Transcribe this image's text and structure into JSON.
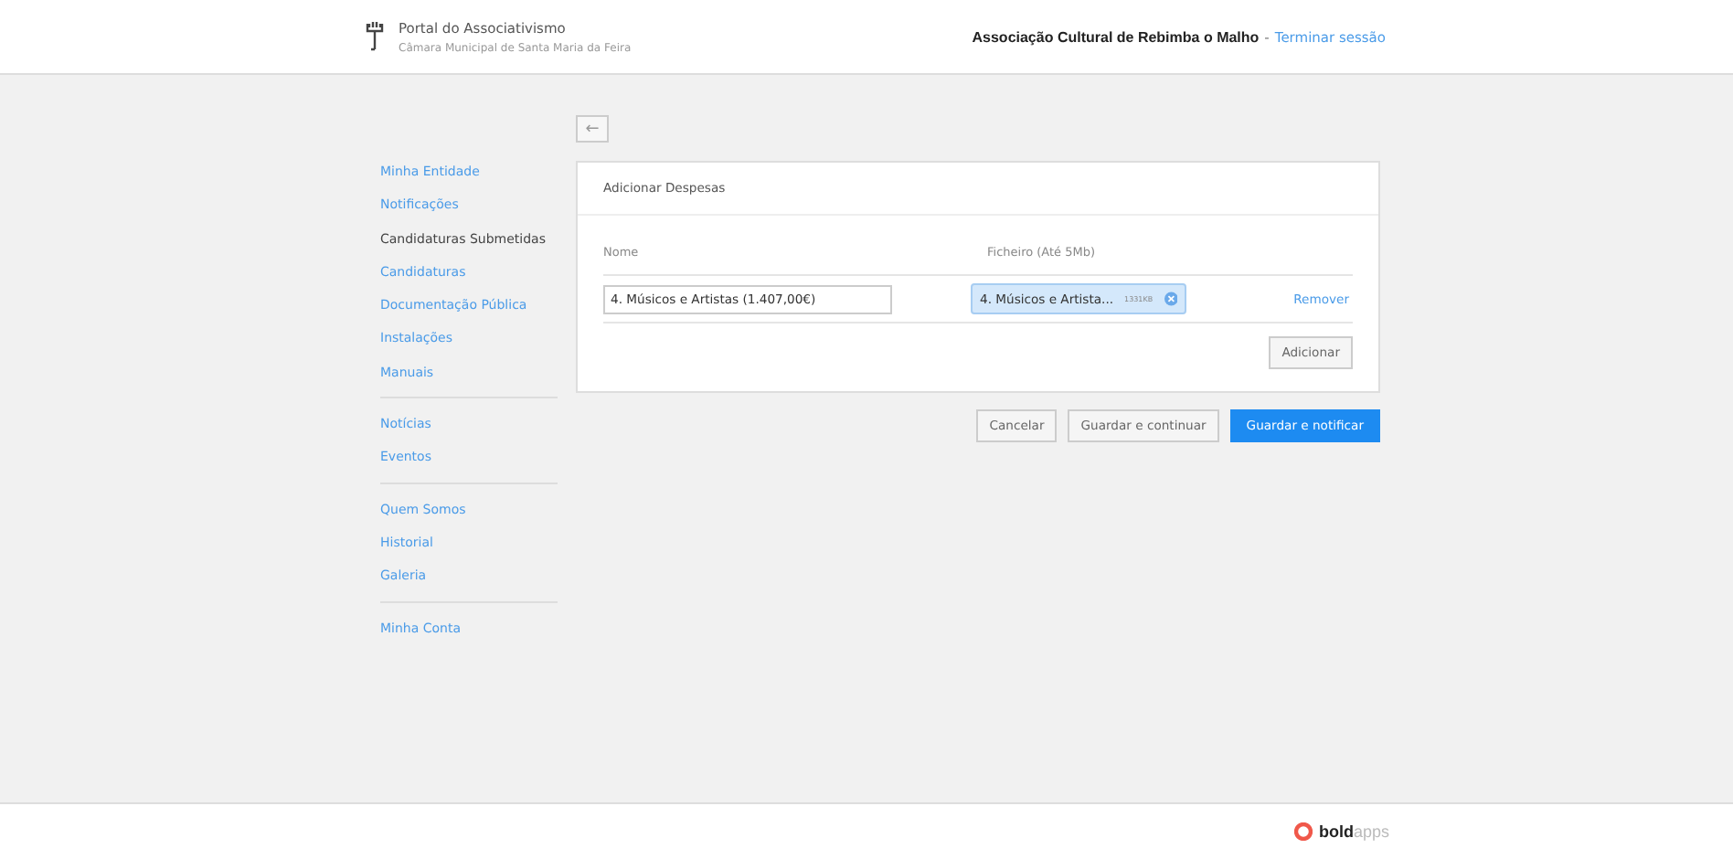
{
  "header": {
    "portal_title": "Portal do Associativismo",
    "portal_subtitle": "Câmara Municipal de Santa Maria da Feira",
    "entity": "Associação Cultural de Rebimba o Malho",
    "separator": "-",
    "logout": "Terminar sessão"
  },
  "sidebar": {
    "groups": [
      {
        "items": [
          {
            "label": "Minha Entidade",
            "selected": false
          },
          {
            "label": "Notificações",
            "selected": false
          },
          {
            "label": "Candidaturas Submetidas",
            "selected": true
          },
          {
            "label": "Candidaturas",
            "selected": false
          },
          {
            "label": "Documentação Pública",
            "selected": false
          },
          {
            "label": "Instalações",
            "selected": false
          },
          {
            "label": "Manuais",
            "selected": false
          }
        ]
      },
      {
        "items": [
          {
            "label": "Notícias",
            "selected": false
          },
          {
            "label": "Eventos",
            "selected": false
          }
        ]
      },
      {
        "items": [
          {
            "label": "Quem Somos",
            "selected": false
          },
          {
            "label": "Historial",
            "selected": false
          },
          {
            "label": "Galeria",
            "selected": false
          }
        ]
      },
      {
        "items": [
          {
            "label": "Minha Conta",
            "selected": false
          }
        ]
      }
    ]
  },
  "back_button": "←",
  "card": {
    "title": "Adicionar Despesas",
    "columns": [
      "Nome",
      "Ficheiro (Até 5Mb)"
    ],
    "rows": [
      {
        "name": "4. Músicos e Artistas (1.407,00€)",
        "file_name": "4. Músicos e Artista...",
        "file_size": "1331KB",
        "remove": "Remover"
      }
    ],
    "add_button": "Adicionar"
  },
  "actions": [
    {
      "label": "Cancelar",
      "kind": "secondary"
    },
    {
      "label": "Guardar e continuar",
      "kind": "secondary"
    },
    {
      "label": "Guardar e notificar",
      "kind": "primary"
    }
  ],
  "footer": {
    "logo": "**bold**apps"
  }
}
